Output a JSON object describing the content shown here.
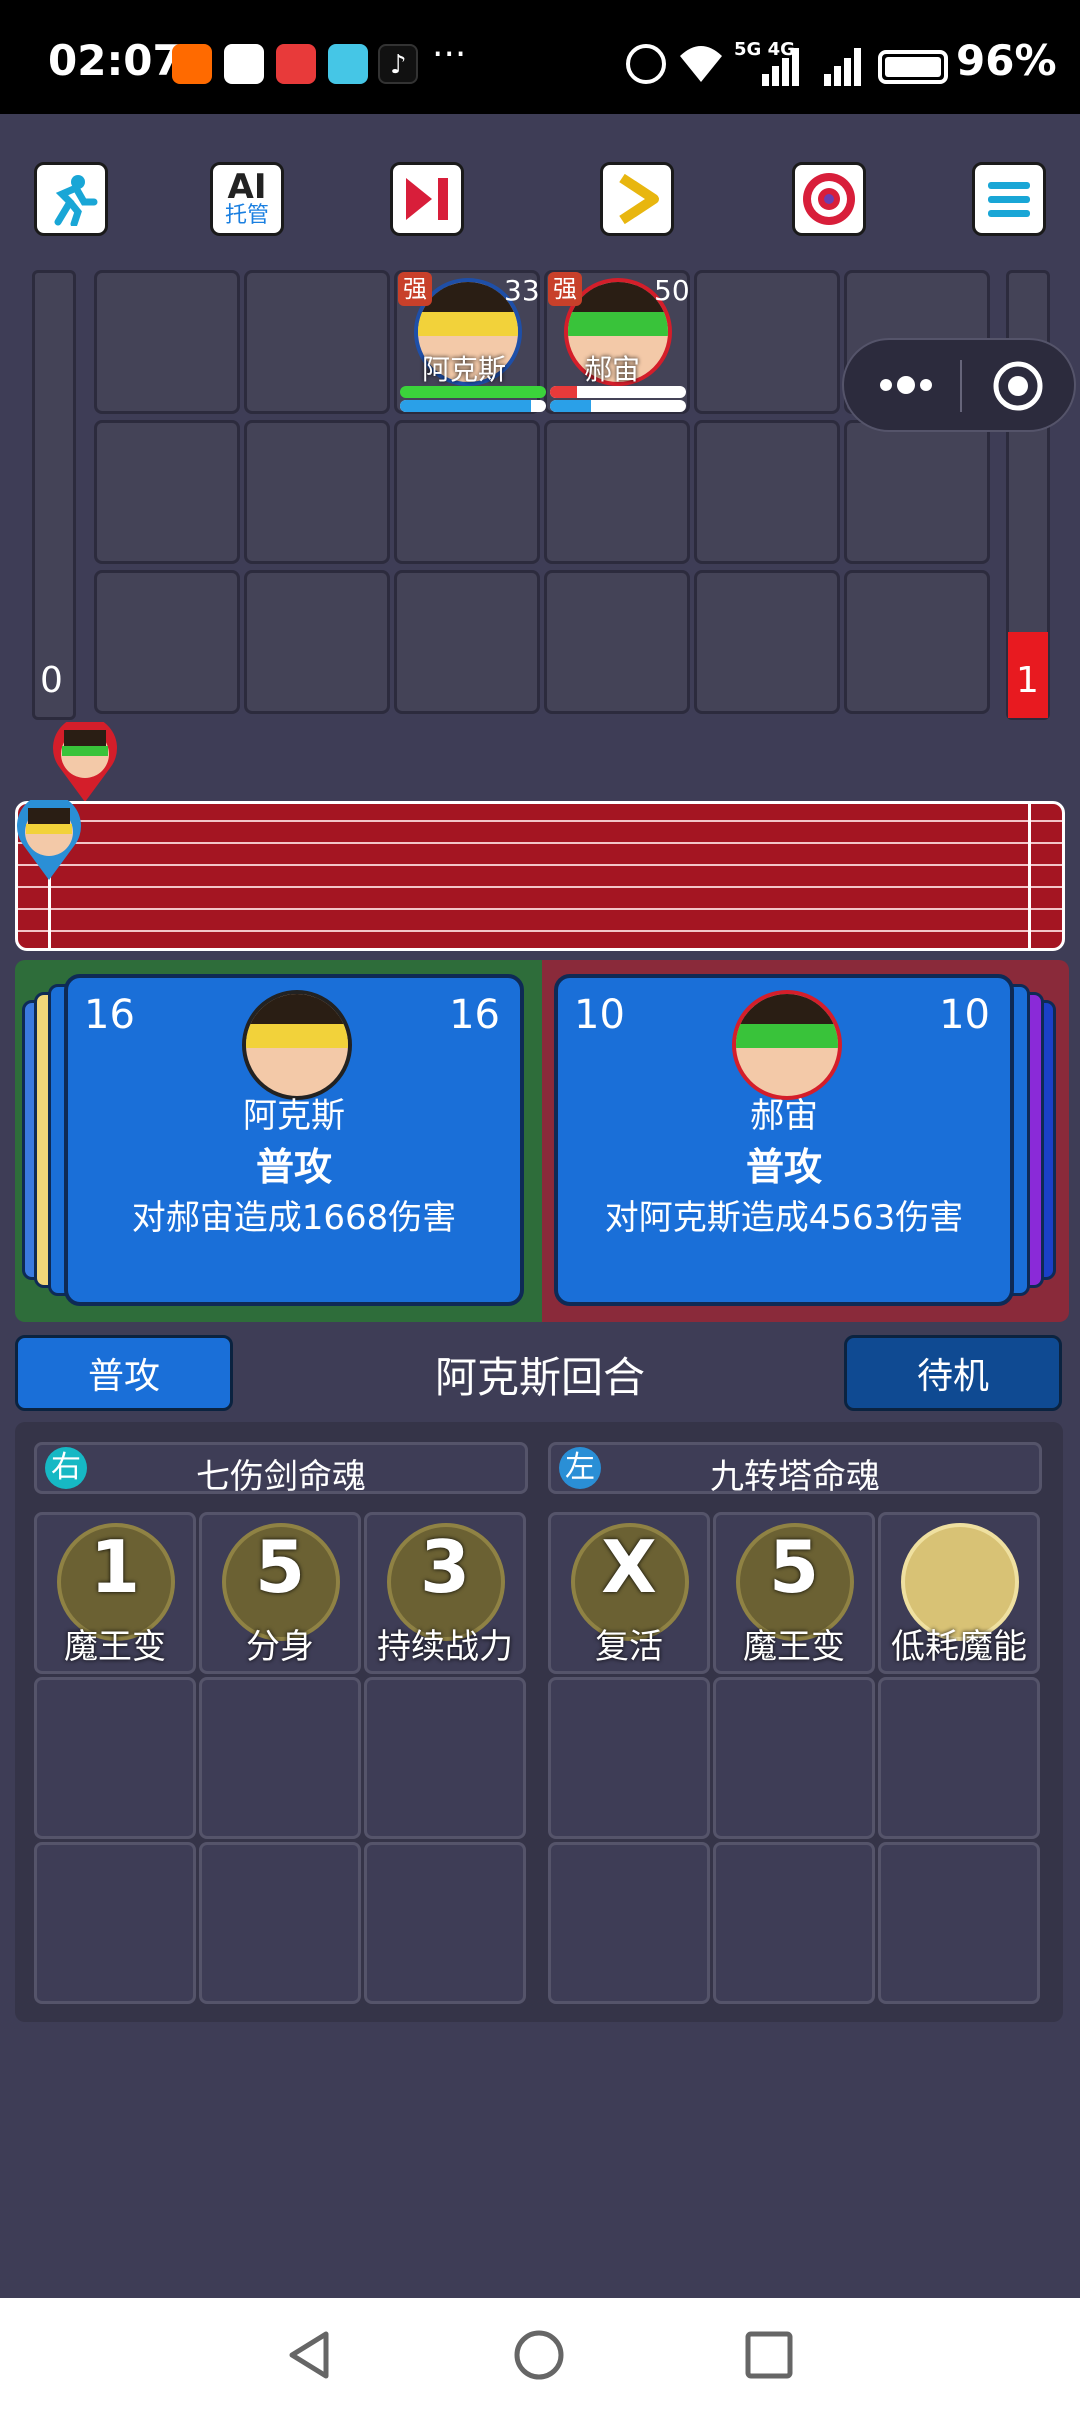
{
  "status_bar": {
    "time": "02:07",
    "overflow": "···",
    "battery": "96%",
    "network": "5G 4G",
    "icons": [
      "taobao-icon",
      "qq-icon",
      "news-icon",
      "book-icon",
      "tiktok-icon",
      "alarm-icon",
      "wifi-icon",
      "signal-icon",
      "battery-icon"
    ]
  },
  "toolbar": {
    "ai_line1": "AI",
    "ai_line2": "托管",
    "buttons": [
      "run-icon",
      "ai-manage-button",
      "skip-icon",
      "play-icon",
      "target-icon",
      "menu-icon"
    ]
  },
  "board": {
    "left_score": "0",
    "right_score": "1",
    "units": [
      {
        "badge": "强",
        "level": "33",
        "name": "阿克斯",
        "hp": 1.0,
        "mp": 0.9
      },
      {
        "badge": "强",
        "level": "50",
        "name": "郝宙",
        "hp": 0.2,
        "mp": 0.3
      }
    ]
  },
  "cards": {
    "left": {
      "left_num": "16",
      "right_num": "16",
      "name": "阿克斯",
      "action": "普攻",
      "desc": "对郝宙造成1668伤害"
    },
    "right": {
      "left_num": "10",
      "right_num": "10",
      "name": "郝宙",
      "action": "普攻",
      "desc": "对阿克斯造成4563伤害"
    }
  },
  "action_bar": {
    "attack_label": "普攻",
    "turn_text": "阿克斯回合",
    "standby_label": "待机"
  },
  "souls": {
    "left": {
      "side": "右",
      "title": "七伤剑命魂",
      "slots": [
        {
          "num": "1",
          "label": "魔王变"
        },
        {
          "num": "5",
          "label": "分身"
        },
        {
          "num": "3",
          "label": "持续战力"
        }
      ]
    },
    "right": {
      "side": "左",
      "title": "九转塔命魂",
      "slots": [
        {
          "num": "X",
          "label": "复活"
        },
        {
          "num": "5",
          "label": "魔王变"
        },
        {
          "num": "",
          "label": "低耗魔能"
        }
      ]
    }
  },
  "colors": {
    "bg": "#3e3d56",
    "card_blue": "#1a6fd8",
    "left_panel": "#2e6d3a",
    "right_panel": "#8a2a3a",
    "track_red": "#a41522",
    "hp_green": "#3bd33b",
    "mp_blue": "#2aa0e8"
  }
}
